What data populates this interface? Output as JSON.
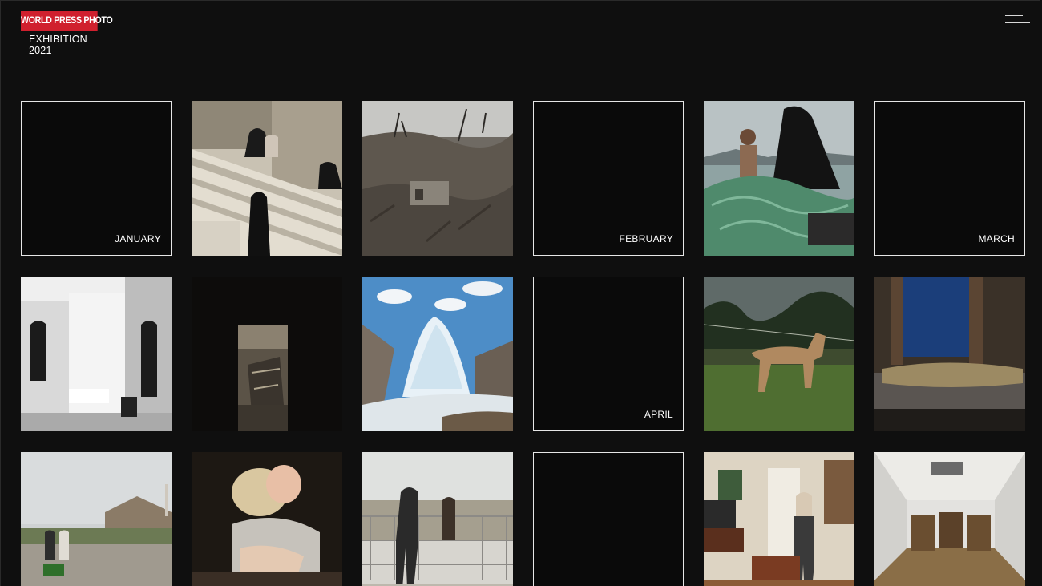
{
  "header": {
    "logo_text": "WORLD PRESS PHOTO",
    "subtitle_line1": "EXHIBITION",
    "subtitle_line2": "2021",
    "menu_icon": "hamburger-menu-icon"
  },
  "colors": {
    "background": "#0f0f0f",
    "brand_red": "#d0202e",
    "tile_border": "#e6e6e6"
  },
  "months": {
    "january": "JANUARY",
    "february": "FEBRUARY",
    "march": "MARCH",
    "april": "APRIL"
  }
}
